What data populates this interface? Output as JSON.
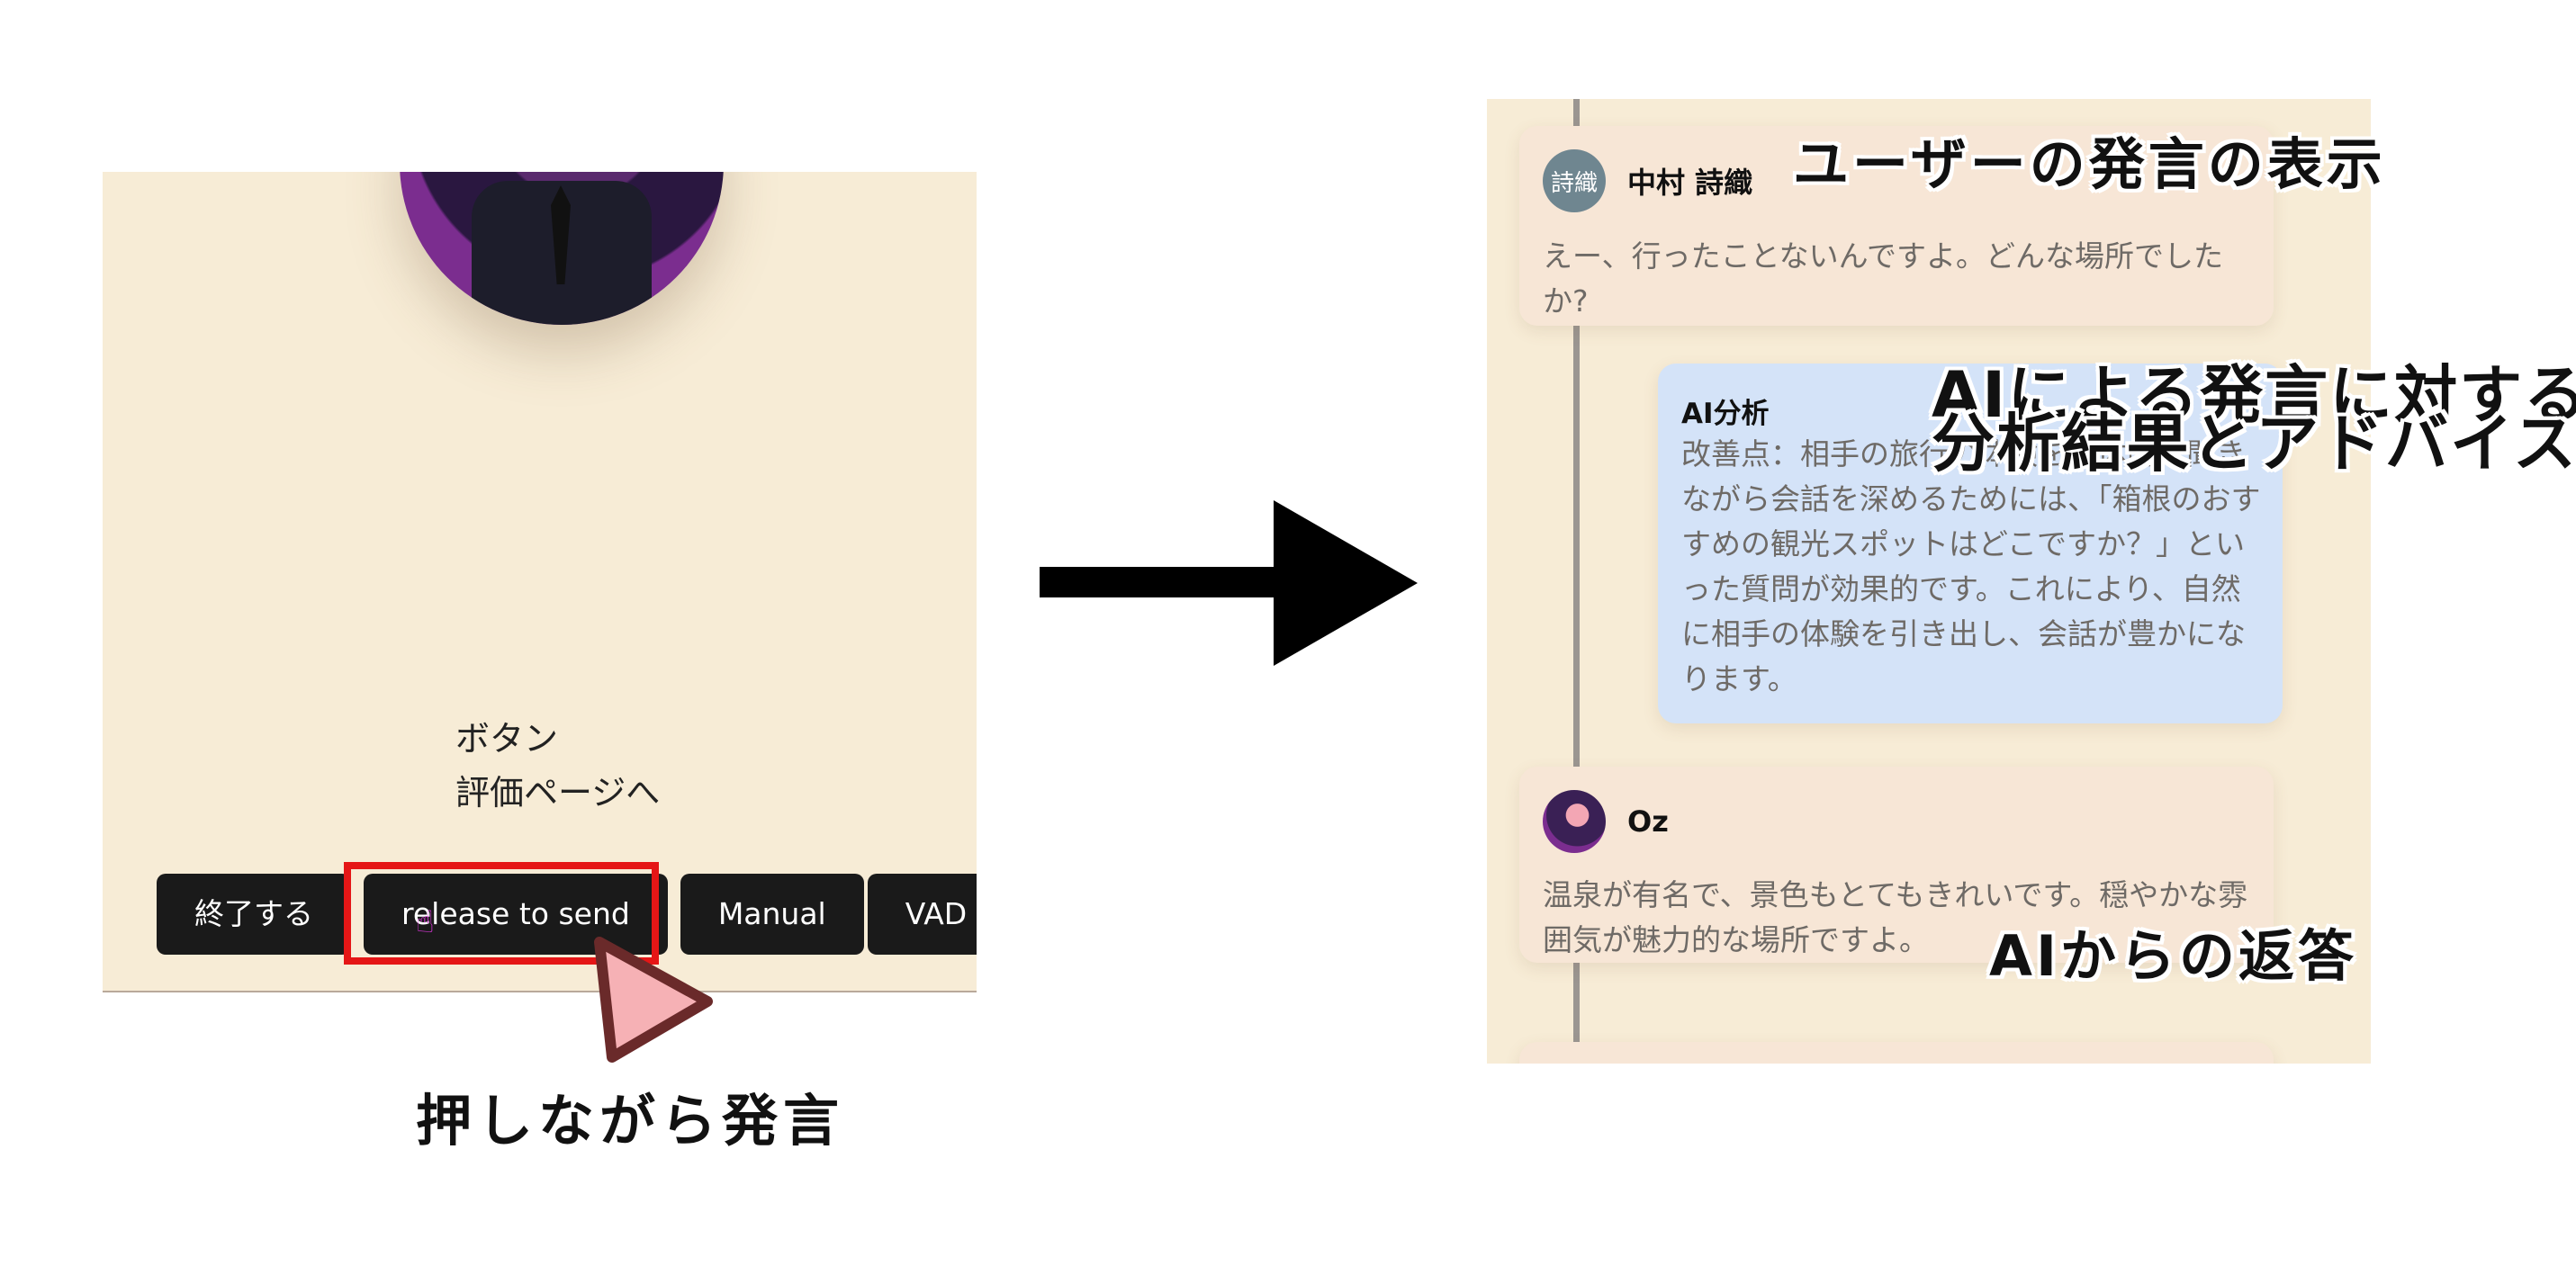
{
  "left": {
    "labels": [
      "ボタン",
      "評価ページへ"
    ],
    "toolbar": {
      "end_label": "終了する",
      "release_label": "release to send",
      "manual_label": "Manual",
      "vad_label": "VAD"
    },
    "push_to_talk_caption": "押しながら発言"
  },
  "right": {
    "user_message": {
      "avatar_text": "詩織",
      "name": "中村 詩織",
      "text": "えー、行ったことないんですよ。どんな場所でしたか?"
    },
    "ai_analysis": {
      "title": "AI分析",
      "text": "改善点：相手の旅行の体験を具体的に聞きながら会話を深めるためには、「箱根のおすすめの観光スポットはどこですか？」といった質問が効果的です。これにより、自然に相手の体験を引き出し、会話が豊かになります。"
    },
    "ai_reply": {
      "name": "Oz",
      "text": "温泉が有名で、景色もとてもきれいです。穏やかな雰囲気が魅力的な場所ですよ。"
    }
  },
  "annotations": {
    "user_message": "ユーザーの発言の表示",
    "ai_analysis_line1": "AIによる発言に対する",
    "ai_analysis_line2": "分析結果とアドバイス",
    "ai_reply": "AIからの返答"
  },
  "colors": {
    "panel_bg": "#f7ecd6",
    "message_bg": "#f7e6d6",
    "analysis_bg": "#d4e3f8",
    "button_bg": "#1a1a1a",
    "highlight": "#e51616",
    "callout_pink": "#f6b1b5"
  },
  "icons": [
    "hand-pointer-icon",
    "play-callout-icon",
    "right-arrow-icon"
  ]
}
